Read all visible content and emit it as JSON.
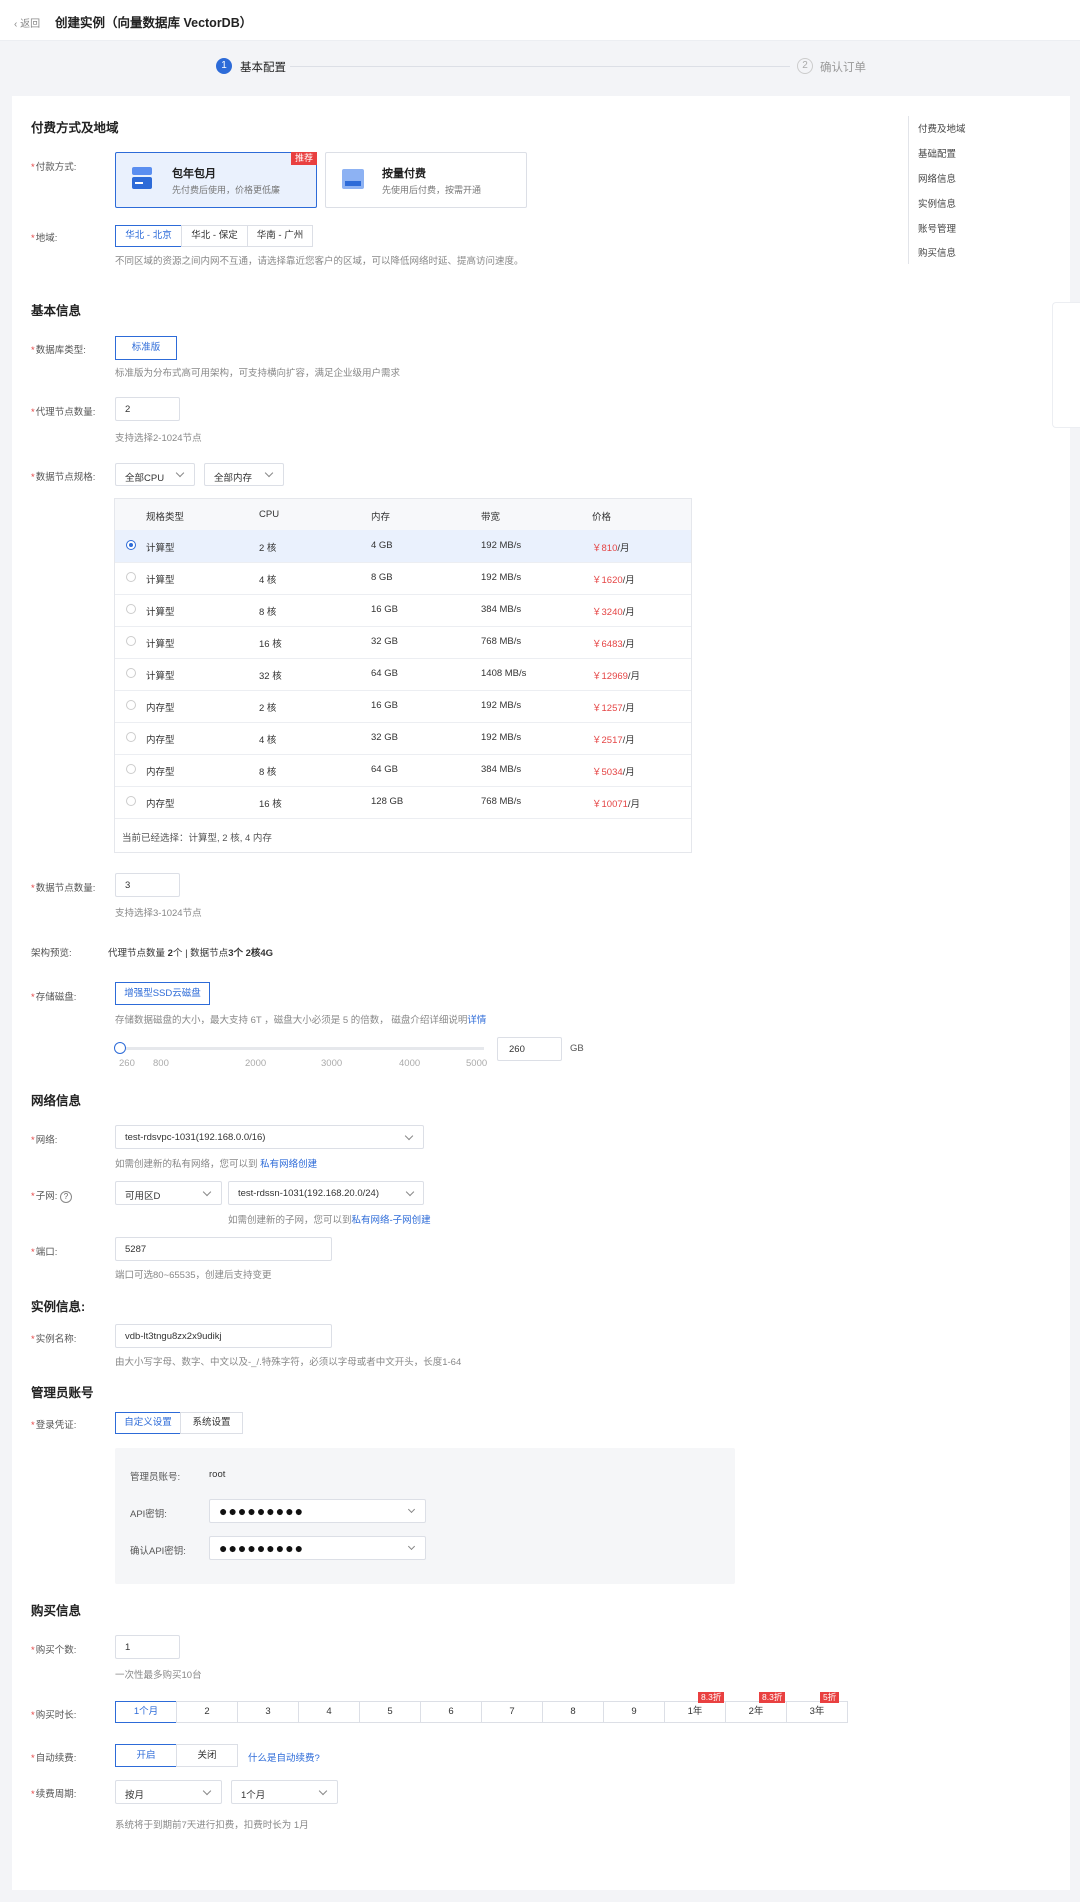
{
  "header": {
    "back_label": "返回",
    "title": "创建实例（向量数据库 VectorDB）"
  },
  "steps": [
    {
      "num": "1",
      "label": "基本配置"
    },
    {
      "num": "2",
      "label": "确认订单"
    }
  ],
  "sections": {
    "billing": "付费方式及地域",
    "basic": "基本信息",
    "network": "网络信息",
    "instance": "实例信息:",
    "admin": "管理员账号",
    "purchase": "购买信息"
  },
  "billing": {
    "pay_label": "付款方式:",
    "options": [
      {
        "title": "包年包月",
        "desc": "先付费后使用，价格更低廉",
        "badge": "推荐"
      },
      {
        "title": "按量付费",
        "desc": "先使用后付费，按需开通"
      }
    ],
    "region_label": "地域:",
    "regions": [
      "华北 - 北京",
      "华北 - 保定",
      "华南 - 广州"
    ],
    "region_hint": "不同区域的资源之间内网不互通，请选择靠近您客户的区域，可以降低网络时延、提高访问速度。"
  },
  "basic": {
    "db_type_label": "数据库类型:",
    "db_type_value": "标准版",
    "db_type_hint": "标准版为分布式高可用架构，可支持横向扩容，满足企业级用户需求",
    "proxy_label": "代理节点数量:",
    "proxy_value": "2",
    "proxy_hint": "支持选择2-1024节点",
    "spec_label": "数据节点规格:",
    "cpu_filter": "全部CPU",
    "mem_filter": "全部内存",
    "table": {
      "headers": [
        "规格类型",
        "CPU",
        "内存",
        "带宽",
        "价格"
      ],
      "rows": [
        {
          "type": "计算型",
          "cpu": "2 核",
          "mem": "4 GB",
          "bw": "192 MB/s",
          "price": "￥810",
          "unit": "/月"
        },
        {
          "type": "计算型",
          "cpu": "4 核",
          "mem": "8 GB",
          "bw": "192 MB/s",
          "price": "￥1620",
          "unit": "/月"
        },
        {
          "type": "计算型",
          "cpu": "8 核",
          "mem": "16 GB",
          "bw": "384 MB/s",
          "price": "￥3240",
          "unit": "/月"
        },
        {
          "type": "计算型",
          "cpu": "16 核",
          "mem": "32 GB",
          "bw": "768 MB/s",
          "price": "￥6483",
          "unit": "/月"
        },
        {
          "type": "计算型",
          "cpu": "32 核",
          "mem": "64 GB",
          "bw": "1408 MB/s",
          "price": "￥12969",
          "unit": "/月"
        },
        {
          "type": "内存型",
          "cpu": "2 核",
          "mem": "16 GB",
          "bw": "192 MB/s",
          "price": "￥1257",
          "unit": "/月"
        },
        {
          "type": "内存型",
          "cpu": "4 核",
          "mem": "32 GB",
          "bw": "192 MB/s",
          "price": "￥2517",
          "unit": "/月"
        },
        {
          "type": "内存型",
          "cpu": "8 核",
          "mem": "64 GB",
          "bw": "384 MB/s",
          "price": "￥5034",
          "unit": "/月"
        },
        {
          "type": "内存型",
          "cpu": "16 核",
          "mem": "128 GB",
          "bw": "768 MB/s",
          "price": "￥10071",
          "unit": "/月"
        }
      ],
      "footer": "当前已经选择：计算型, 2 核, 4 内存"
    },
    "data_nodes_label": "数据节点数量:",
    "data_nodes_value": "3",
    "data_nodes_hint": "支持选择3-1024节点",
    "arch_label": "架构预览:",
    "arch_a": "代理节点数量 ",
    "arch_b": "2",
    "arch_c": "个 | 数据节点",
    "arch_d": "3个 2核4G",
    "storage_label": "存储磁盘:",
    "storage_value": "增强型SSD云磁盘",
    "storage_hint": "存储数据磁盘的大小，最大支持 6T ，磁盘大小必须是 5 的倍数， 磁盘介绍详细说明",
    "storage_link": "详情",
    "slider_ticks": [
      "260",
      "800",
      "2000",
      "3000",
      "4000",
      "5000"
    ],
    "disk_value": "260",
    "disk_unit": "GB"
  },
  "network": {
    "net_label": "网络:",
    "net_value": "test-rdsvpc-1031(192.168.0.0/16)",
    "net_hint": "如需创建新的私有网络，您可以到 ",
    "net_link": "私有网络创建",
    "subnet_label": "子网:",
    "zone_value": "可用区D",
    "subnet_value": "test-rdssn-1031(192.168.20.0/24)",
    "subnet_hint": "如需创建新的子网，您可以到",
    "subnet_link": "私有网络-子网创建",
    "port_label": "端口:",
    "port_value": "5287",
    "port_hint": "端口可选80~65535，创建后支持变更"
  },
  "instance": {
    "name_label": "实例名称:",
    "name_value": "vdb-lt3tngu8zx2x9udikj",
    "name_hint": "由大小写字母、数字、中文以及-_/.特殊字符，必须以字母或者中文开头，长度1-64"
  },
  "admin": {
    "cred_label": "登录凭证:",
    "cred_options": [
      "自定义设置",
      "系统设置"
    ],
    "account_label": "管理员账号:",
    "account_value": "root",
    "key_label": "API密钥:",
    "key_value": "●●●●●●●●●",
    "confirm_label": "确认API密钥:",
    "confirm_value": "●●●●●●●●●"
  },
  "purchase": {
    "count_label": "购买个数:",
    "count_value": "1",
    "count_hint": "一次性最多购买10台",
    "duration_label": "购买时长:",
    "durations": [
      "1个月",
      "2",
      "3",
      "4",
      "5",
      "6",
      "7",
      "8",
      "9",
      "1年",
      "2年",
      "3年"
    ],
    "discounts": {
      "9": "8.3折",
      "10": "8.3折",
      "11": "5折"
    },
    "renew_label": "自动续费:",
    "renew_options": [
      "开启",
      "关闭"
    ],
    "renew_link": "什么是自动续费?",
    "cycle_label": "续费周期:",
    "cycle_unit": "按月",
    "cycle_value": "1个月",
    "cycle_hint": "系统将于到期前7天进行扣费，扣费时长为 1月"
  },
  "right_nav": [
    "付费及地域",
    "基础配置",
    "网络信息",
    "实例信息",
    "账号管理",
    "购买信息"
  ],
  "colors": {
    "primary": "#2d6bd8",
    "price": "#e54545",
    "badge": "#e94040"
  }
}
